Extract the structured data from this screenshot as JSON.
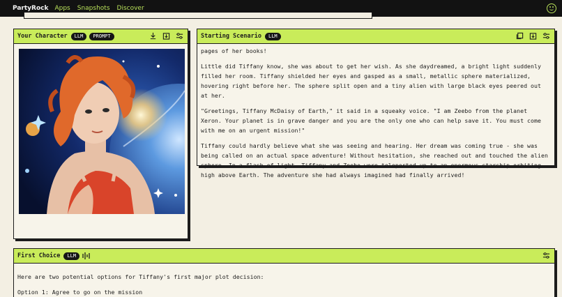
{
  "topbar": {
    "brand": "PartyRock",
    "nav": [
      "Apps",
      "Snapshots",
      "Discover"
    ]
  },
  "character_panel": {
    "title": "Your Character",
    "badges": [
      "LLM",
      "PROMPT"
    ],
    "icons": [
      "download-icon",
      "save-icon",
      "sliders-icon"
    ]
  },
  "scenario_panel": {
    "title": "Starting Scenario",
    "badges": [
      "LLM"
    ],
    "icons": [
      "copy-icon",
      "save-icon",
      "sliders-icon"
    ],
    "paragraphs": [
      "pages of her books!",
      "Little did Tiffany know, she was about to get her wish. As she daydreamed, a bright light suddenly filled her room. Tiffany shielded her eyes and gasped as a small, metallic sphere materialized, hovering right before her. The sphere split open and a tiny alien with large black eyes peered out at her.",
      "\"Greetings, Tiffany McDaisy of Earth,\" it said in a squeaky voice. \"I am Zeebo from the planet Xeron. Your planet is in grave danger and you are the only one who can help save it. You must come with me on an urgent mission!\"",
      "Tiffany could hardly believe what she was seeing and hearing. Her dream was coming true - she was being called on an actual space adventure! Without hesitation, she reached out and touched the alien sphere. In a flash of light, Tiffany and Zeebo were teleported up to an enormous starship orbiting high above Earth. The adventure she had always imagined had finally arrived!"
    ]
  },
  "choice_panel": {
    "title": "First Choice",
    "badges": [
      "LLM"
    ],
    "icons": [
      "sliders-icon"
    ],
    "paragraphs": [
      "Here are two potential options for Tiffany's first major plot decision:",
      "Option 1: Agree to go on the mission"
    ]
  },
  "colors": {
    "accent": "#c9ec5a",
    "topbar": "#121212",
    "nav": "#b8e05a",
    "background": "#f3efe3"
  }
}
